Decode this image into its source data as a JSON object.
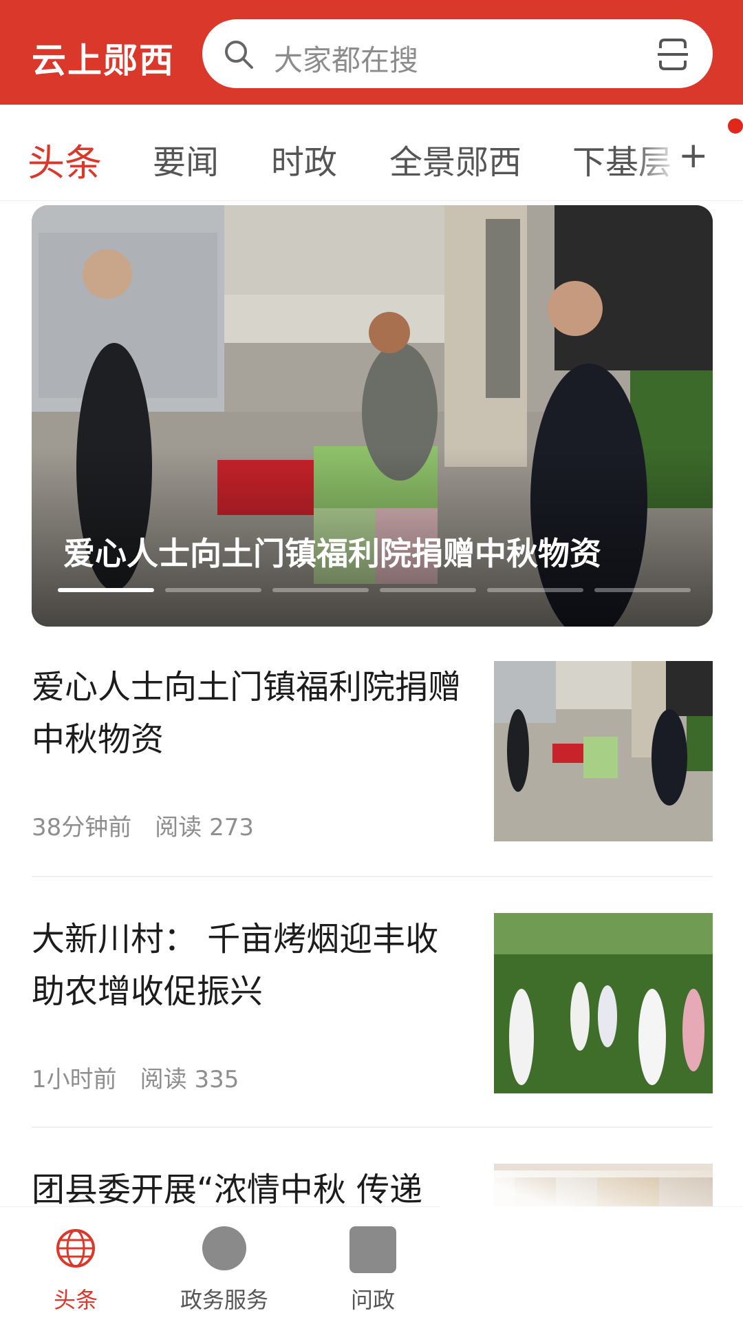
{
  "header": {
    "app_title": "云上郧西",
    "search_placeholder": "大家都在搜",
    "colors": {
      "brand": "#d9382b"
    }
  },
  "channels": {
    "tabs": [
      {
        "label": "头条",
        "active": true
      },
      {
        "label": "要闻",
        "active": false
      },
      {
        "label": "时政",
        "active": false
      },
      {
        "label": "全景郧西",
        "active": false
      },
      {
        "label": "下基层",
        "active": false
      }
    ],
    "add_icon": "plus-icon",
    "notification_dot": true
  },
  "banner": {
    "title": "爱心人士向土门镇福利院捐赠中秋物资",
    "slide_count": 6,
    "active_slide": 1
  },
  "articles": [
    {
      "title": "爱心人士向土门镇福利院捐赠中秋物资",
      "time": "38分钟前",
      "reads": "阅读 273"
    },
    {
      "title": "大新川村： 千亩烤烟迎丰收 助农增收促振兴",
      "time": "1小时前",
      "reads": "阅读 335"
    },
    {
      "title": "团县委开展“浓情中秋 传递"
    }
  ],
  "bottom_nav": [
    {
      "label": "头条",
      "icon": "globe-icon",
      "active": true
    },
    {
      "label": "政务服务",
      "icon": "placeholder-circle-icon",
      "active": false
    },
    {
      "label": "问政",
      "icon": "placeholder-square-icon",
      "active": false
    }
  ]
}
